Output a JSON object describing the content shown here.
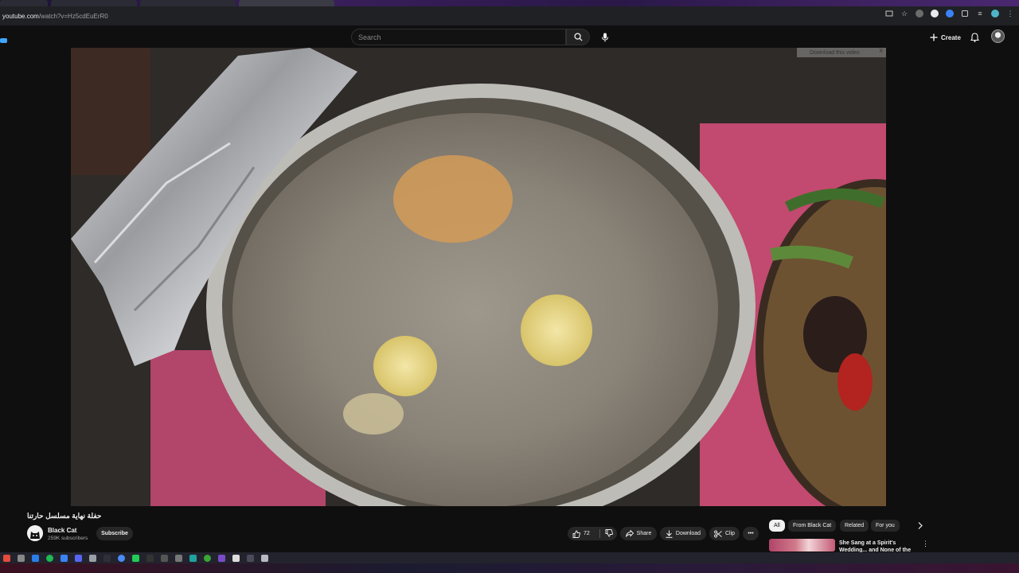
{
  "browser": {
    "url_host": "youtube.com",
    "url_path": "/watch?v=Hz5cdEuErR0"
  },
  "masthead": {
    "search_placeholder": "Search",
    "create_label": "Create"
  },
  "video": {
    "download_banner": "Download this video",
    "download_banner_close": "X"
  },
  "watch": {
    "title": "حفلة نهاية مسلسل حارتنا",
    "channel_name": "Black Cat",
    "subscribers": "259K subscribers",
    "subscribe_label": "Subscribe",
    "like_count": "72",
    "share_label": "Share",
    "download_label": "Download",
    "clip_label": "Clip"
  },
  "related": {
    "chips": [
      "All",
      "From Black Cat",
      "Related",
      "For you"
    ],
    "active_chip": "All",
    "first_item_title": "She Sang at a Spirit's Wedding... and None of the Guests Were..."
  },
  "colors": {
    "background": "#0f0f0f",
    "pill": "#272727",
    "text": "#f1f1f1",
    "muted": "#aaaaaa"
  }
}
